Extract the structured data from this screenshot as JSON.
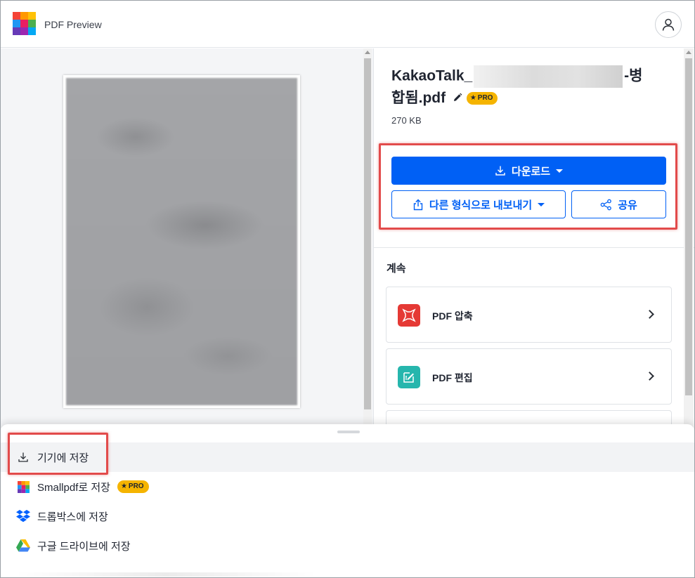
{
  "header": {
    "app_title": "PDF Preview",
    "logo_colors": [
      "#f44336",
      "#ff9800",
      "#ffc107",
      "#2196f3",
      "#e91e63",
      "#4caf50",
      "#673ab7",
      "#9c27b0",
      "#03a9f4"
    ]
  },
  "file": {
    "name_prefix": "KakaoTalk_",
    "name_suffix": "-병합됨.pdf",
    "pro_label": "PRO",
    "size": "270 KB"
  },
  "actions": {
    "download_label": "다운로드",
    "export_label": "다른 형식으로 내보내기",
    "share_label": "공유"
  },
  "continue": {
    "title": "계속",
    "tools": [
      {
        "label": "PDF 압축",
        "icon": "compress-icon",
        "color": "#e53935"
      },
      {
        "label": "PDF 편집",
        "icon": "edit-pdf-icon",
        "color": "#26b6ad"
      }
    ]
  },
  "save_menu": {
    "items": [
      {
        "label": "기기에 저장",
        "icon": "download-icon"
      },
      {
        "label": "Smallpdf로 저장",
        "icon": "smallpdf-logo-icon",
        "badge": "PRO"
      },
      {
        "label": "드롭박스에 저장",
        "icon": "dropbox-icon"
      },
      {
        "label": "구글 드라이브에 저장",
        "icon": "google-drive-icon"
      }
    ]
  },
  "colors": {
    "primary": "#0060f5",
    "highlight": "#e24b4b",
    "pro_badge": "#f5b400"
  }
}
